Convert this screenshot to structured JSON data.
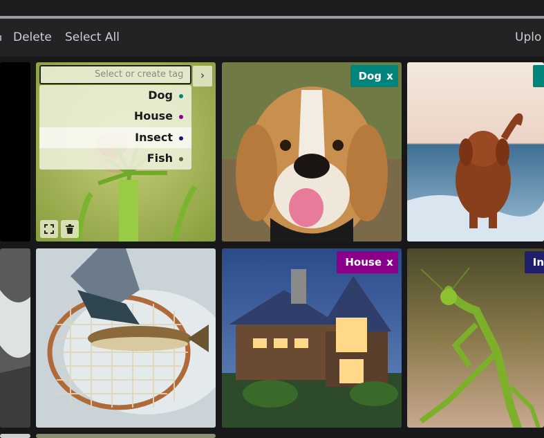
{
  "toolbar": {
    "delete_label": "Delete",
    "select_all_label": "Select All",
    "upload_label": "Uplo"
  },
  "tag_selector": {
    "placeholder": "Select or create tag",
    "go_icon": "chevron-right-icon",
    "options": [
      {
        "label": "Dog",
        "color": "#00857c"
      },
      {
        "label": "House",
        "color": "#8b008b"
      },
      {
        "label": "Insect",
        "color": "#1a1a6e"
      },
      {
        "label": "Fish",
        "color": "#4a6b2a"
      }
    ]
  },
  "tiles": {
    "dog1_tag": "Dog",
    "dog1_tag_color": "#00857c",
    "house_tag": "House",
    "house_tag_color": "#8b008b",
    "insect_tag": "In",
    "insect_tag_color": "#1f1f6e",
    "remove_symbol": "x"
  },
  "icons": {
    "expand": "expand-icon",
    "delete": "trash-icon"
  }
}
